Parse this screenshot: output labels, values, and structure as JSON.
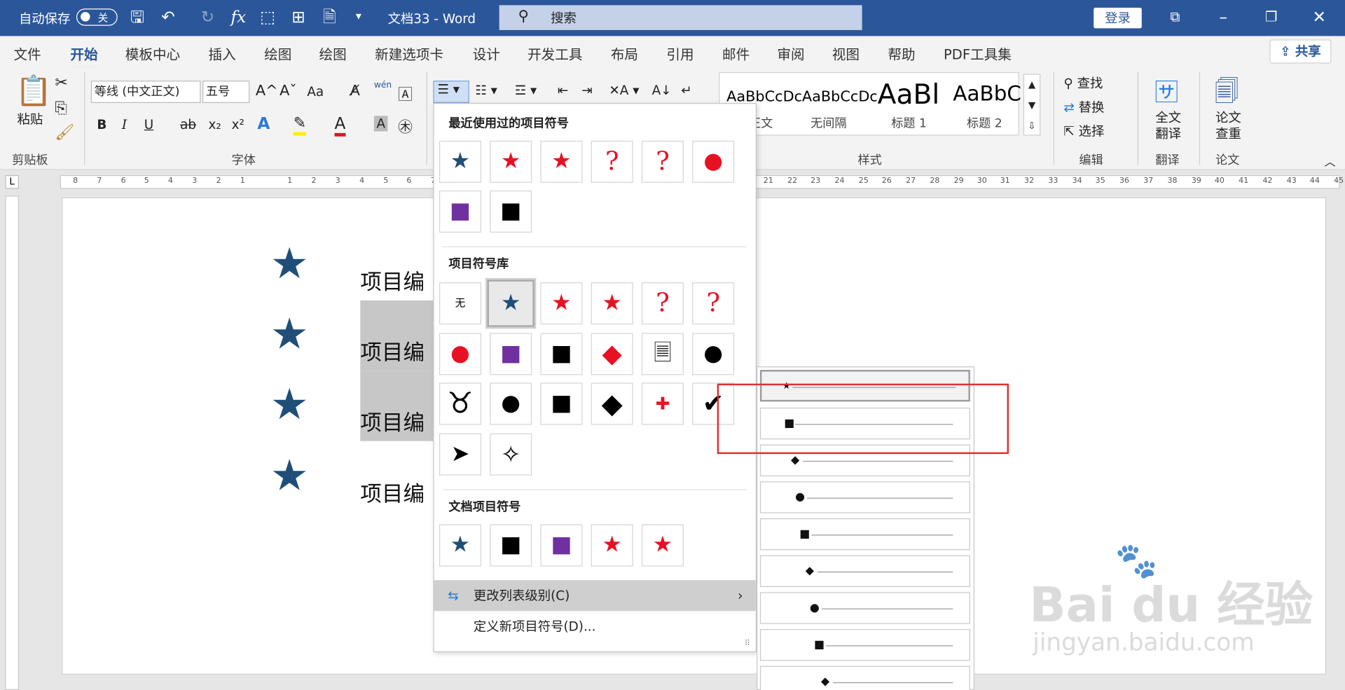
{
  "titlebar": {
    "autosave_label": "自动保存",
    "autosave_state": "关",
    "doc_title": "文档33  -  Word",
    "search_placeholder": "搜索",
    "login": "登录"
  },
  "tabs": [
    "文件",
    "开始",
    "模板中心",
    "插入",
    "绘图",
    "绘图",
    "新建选项卡",
    "设计",
    "开发工具",
    "布局",
    "引用",
    "邮件",
    "审阅",
    "视图",
    "帮助",
    "PDF工具集"
  ],
  "share": "共享",
  "ribbon": {
    "clipboard": {
      "paste": "粘贴",
      "group": "剪贴板"
    },
    "font": {
      "name": "等线 (中文正文)",
      "size": "五号",
      "group": "字体",
      "bold": "B",
      "italic": "I",
      "underline": "U",
      "strike": "ab",
      "sub": "x₂",
      "sup": "x²",
      "grow": "A^",
      "shrink": "Aˇ",
      "case": "Aa",
      "wen": "wén"
    },
    "styles": {
      "items": [
        "AaBbCcDc",
        "AaBbCcDc",
        "AaBl",
        "AaBbC"
      ],
      "names": [
        "正文",
        "无间隔",
        "标题 1",
        "标题 2"
      ],
      "group": "样式"
    },
    "editing": {
      "find": "查找",
      "replace": "替换",
      "select": "选择",
      "group": "编辑"
    },
    "translate": {
      "label1": "全文",
      "label2": "翻译",
      "group": "翻译"
    },
    "paper": {
      "label1": "论文",
      "label2": "查重",
      "group": "论文"
    }
  },
  "ruler_numbers": [
    "8",
    "7",
    "6",
    "5",
    "4",
    "3",
    "2",
    "1",
    "1",
    "2",
    "3",
    "4",
    "5",
    "6",
    "7",
    "21",
    "22",
    "23",
    "24",
    "25",
    "26",
    "27",
    "28",
    "29",
    "30",
    "31",
    "32",
    "33",
    "34",
    "35",
    "36",
    "37",
    "38",
    "39",
    "40",
    "41",
    "42",
    "43",
    "44",
    "45"
  ],
  "document": {
    "lines": [
      "项目编",
      "项目编",
      "项目编",
      "项目编"
    ]
  },
  "bullet_dropdown": {
    "recent_heading": "最近使用过的项目符号",
    "library_heading": "项目符号库",
    "document_heading": "文档项目符号",
    "none_label": "无",
    "change_level": "更改列表级别(C)",
    "define_new": "定义新项目符号(D)..."
  },
  "colors": {
    "brand": "#2b579a",
    "navy_star": "#1f4e79",
    "red": "#e81123",
    "purple": "#7030a0",
    "highlight_box": "#e03030"
  },
  "watermark": {
    "brand": "Bai du 经验",
    "url": "jingyan.baidu.com"
  }
}
